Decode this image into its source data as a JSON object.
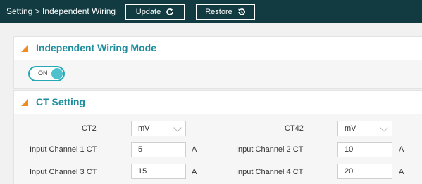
{
  "header": {
    "breadcrumb": "Setting > Independent Wiring",
    "update_label": "Update",
    "restore_label": "Restore"
  },
  "independent_wiring": {
    "title": "Independent Wiring Mode",
    "toggle_label": "ON",
    "toggle_on": true
  },
  "ct_setting": {
    "title": "CT Setting",
    "ct_selects": [
      {
        "label": "CT2",
        "value": "mV"
      },
      {
        "label": "CT42",
        "value": "mV"
      }
    ],
    "channels": [
      {
        "label": "Input Channel 1 CT",
        "value": "5",
        "unit": "A"
      },
      {
        "label": "Input Channel 2 CT",
        "value": "10",
        "unit": "A"
      },
      {
        "label": "Input Channel 3 CT",
        "value": "15",
        "unit": "A"
      },
      {
        "label": "Input Channel 4 CT",
        "value": "20",
        "unit": "A"
      }
    ]
  },
  "colors": {
    "topbar": "#123a41",
    "accent": "#1e8e9e",
    "triangle": "#f08c1e",
    "toggle": "#25a9b6"
  }
}
